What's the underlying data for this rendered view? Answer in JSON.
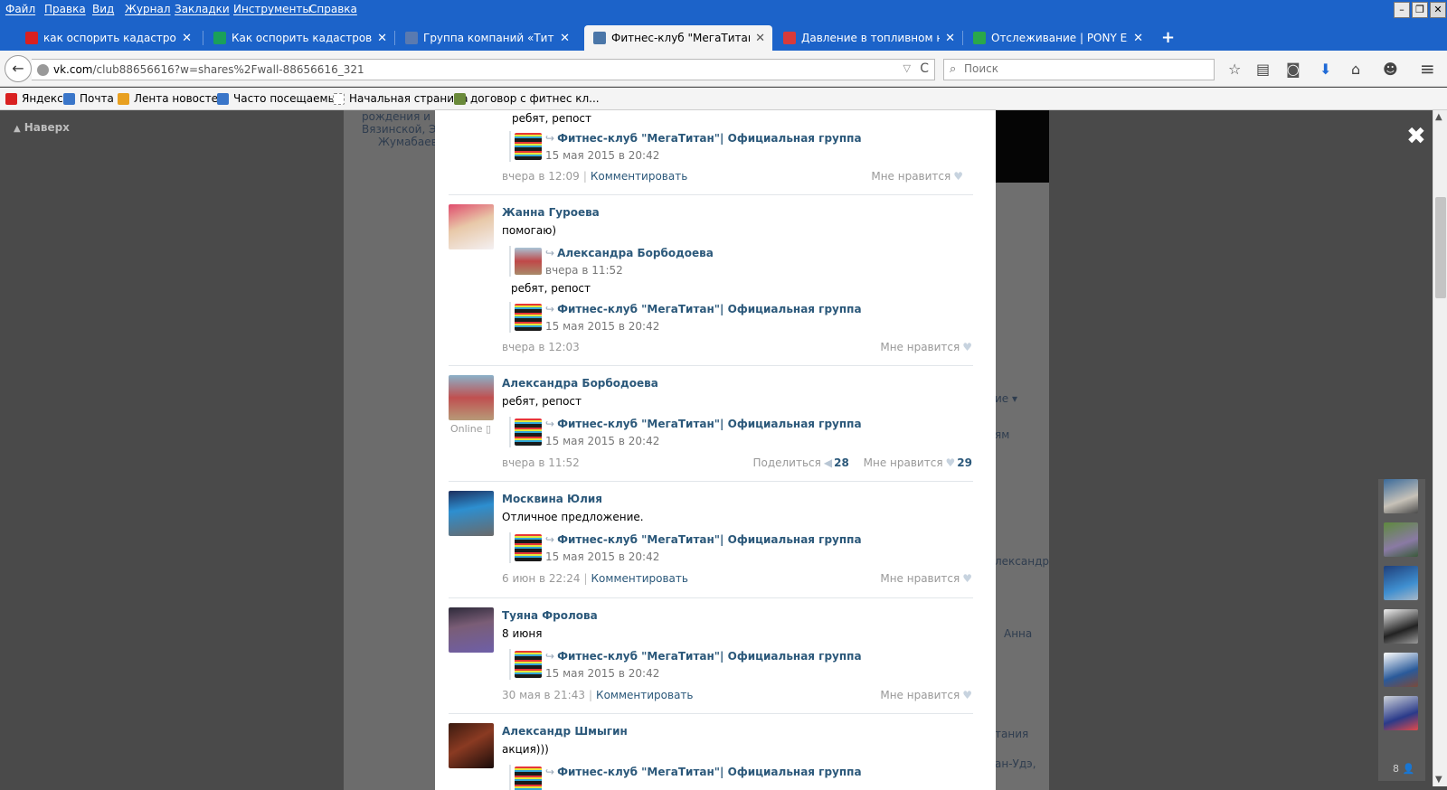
{
  "menu": [
    "Файл",
    "Правка",
    "Вид",
    "Журнал",
    "Закладки",
    "Инструменты",
    "Справка"
  ],
  "window_controls": {
    "minimize": "–",
    "restore": "❐",
    "close": "✕"
  },
  "tabs": [
    {
      "label": "как оспорить кадастровую ...",
      "favicon_color": "#d92020",
      "favicon": "yandex-icon"
    },
    {
      "label": "Как оспорить кадастровую...",
      "favicon_color": "#1aa05a",
      "favicon": "h-logo-icon"
    },
    {
      "label": "Группа компаний «Титан»",
      "favicon_color": "#5a7ab0",
      "favicon": "titan-icon"
    },
    {
      "label": "Фитнес-клуб \"МегаТитан\"| ...",
      "favicon_color": "#4a76a8",
      "favicon": "vk-icon",
      "active": true
    },
    {
      "label": "Давление в топливном насо...",
      "favicon_color": "#d83a3a",
      "favicon": "drive-icon"
    },
    {
      "label": "Отслеживание | PONY EXPR...",
      "favicon_color": "#2aa84a",
      "favicon": "pony-icon"
    }
  ],
  "tab_close": "✕",
  "new_tab": "+",
  "nav": {
    "back": "←",
    "url_host": "vk.com",
    "url_path": "/club88656616?w=shares%2Fwall-88656616_321",
    "url_dropdown": "▽",
    "reload": "C",
    "search_placeholder": "Поиск",
    "icons": {
      "bookmark": "☆",
      "reading": "▤",
      "pocket": "◙",
      "download": "⬇",
      "home": "⌂",
      "chat": "☻",
      "menu": "≡"
    }
  },
  "bookmarks": [
    {
      "label": "Яндекс",
      "color": "#d92020"
    },
    {
      "label": "Почта",
      "color": "#3a76c9"
    },
    {
      "label": "Лента новостей",
      "color": "#e8a020"
    },
    {
      "label": "Часто посещаемые",
      "color": "#3a76c9"
    },
    {
      "label": "Начальная страница",
      "color": "#888888"
    },
    {
      "label": "договор с фитнес кл...",
      "color": "#6a8a3a"
    }
  ],
  "page": {
    "to_top": "Наверх",
    "to_top_arrow": "▲",
    "close_layer": "✖",
    "bg_left_lines": [
      "рождения и",
      "Вязинской, Э",
      "Жумабаев"
    ],
    "bg_right_texts": [
      "ие ▾",
      "ям",
      "лександр",
      "Анна",
      "тания",
      "ан-Удэ,"
    ],
    "friends_count": "8",
    "friends_icon": "👤"
  },
  "group_name": "Фитнес-клуб \"МегаТитан\"| Официальная группа",
  "group_date": "15 мая 2015 в 20:42",
  "top_fragment": {
    "text": "ребят, репост",
    "footer_date": "вчера в 12:09",
    "comment": "Комментировать",
    "like": "Мне нравится"
  },
  "posts": [
    {
      "author": "Жанна Гуроева",
      "text": "помогаю)",
      "repost_author": "Александра Борбодоева",
      "repost_date": "вчера в 11:52",
      "repost_text": "ребят, репост",
      "footer_date": "вчера в 12:03",
      "like": "Мне нравится"
    },
    {
      "author": "Александра Борбодоева",
      "online": "Online",
      "text": "ребят, репост",
      "footer_date": "вчера в 11:52",
      "share_label": "Поделиться",
      "share_count": "28",
      "like": "Мне нравится",
      "like_count": "29"
    },
    {
      "author": "Москвина Юлия",
      "text": "Отличное предложение.",
      "footer_date": "6 июн в 22:24",
      "comment": "Комментировать",
      "like": "Мне нравится"
    },
    {
      "author": "Туяна Фролова",
      "text": "8 июня",
      "footer_date": "30 мая в 21:43",
      "comment": "Комментировать",
      "like": "Мне нравится"
    },
    {
      "author": "Александр Шмыгин",
      "text": "акция)))"
    }
  ],
  "glyphs": {
    "share_arrow": "↪",
    "heart": "♥",
    "megaphone": "◀",
    "separator": "|"
  }
}
